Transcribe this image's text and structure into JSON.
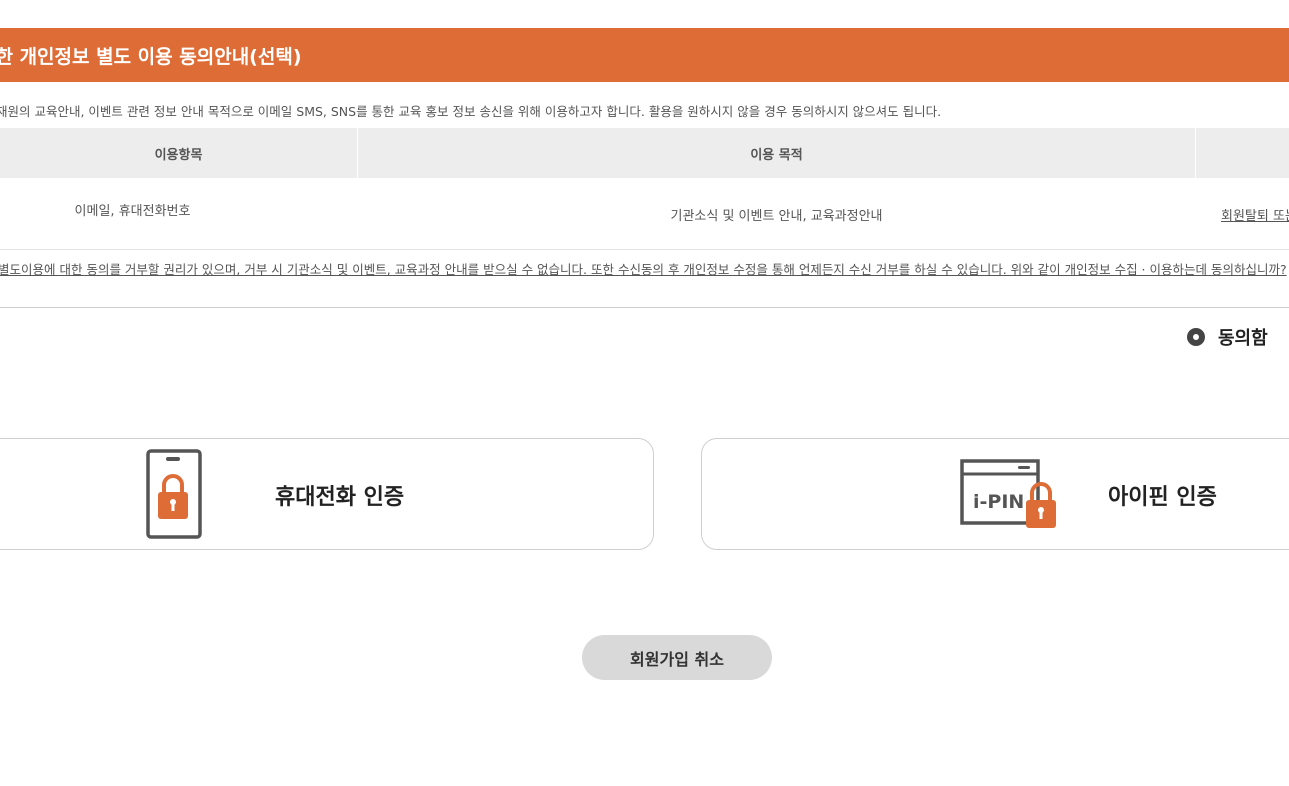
{
  "header": {
    "title": "대한 개인정보 별도 이용 동의안내(선택)"
  },
  "intro": {
    "text": "재원의 교육안내, 이벤트 관련 정보 안내 목적으로 이메일 SMS, SNS를 통한 교육 홍보 정보 송신을 위해 이용하고자 합니다. 활용을 원하시지 않을 경우 동의하시지 않으셔도 됩니다."
  },
  "table": {
    "columns": [
      "이용항목",
      "이용 목적",
      ""
    ],
    "rows": [
      {
        "item": "이메일, 휴대전화번호",
        "purpose": "기관소식 및 이벤트 안내, 교육과정안내",
        "period": "회원탈퇴 또는"
      }
    ]
  },
  "notice": {
    "text": "별도이용에 대한 동의를 거부할 권리가 있으며, 거부 시 기관소식 및 이벤트, 교육과정 안내를 받으실 수 없습니다. 또한 수신동의 후 개인정보 수정을 통해 언제든지 수신 거부를 하실 수 있습니다. 위와 같이 개인정보 수집 · 이용하는데 동의하십니까?"
  },
  "agree": {
    "label": "동의함",
    "selected": true
  },
  "cert": {
    "phone": {
      "label": "휴대전화 인증",
      "icon": "phone-lock-icon"
    },
    "ipin": {
      "label": "아이핀 인증",
      "icon": "ipin-lock-icon",
      "icon_text": "i-PIN"
    }
  },
  "cancel": {
    "label": "회원가입 취소"
  },
  "colors": {
    "accent": "#de6c36",
    "header_bg": "#ededed",
    "button_bg": "#d9d9d9"
  }
}
